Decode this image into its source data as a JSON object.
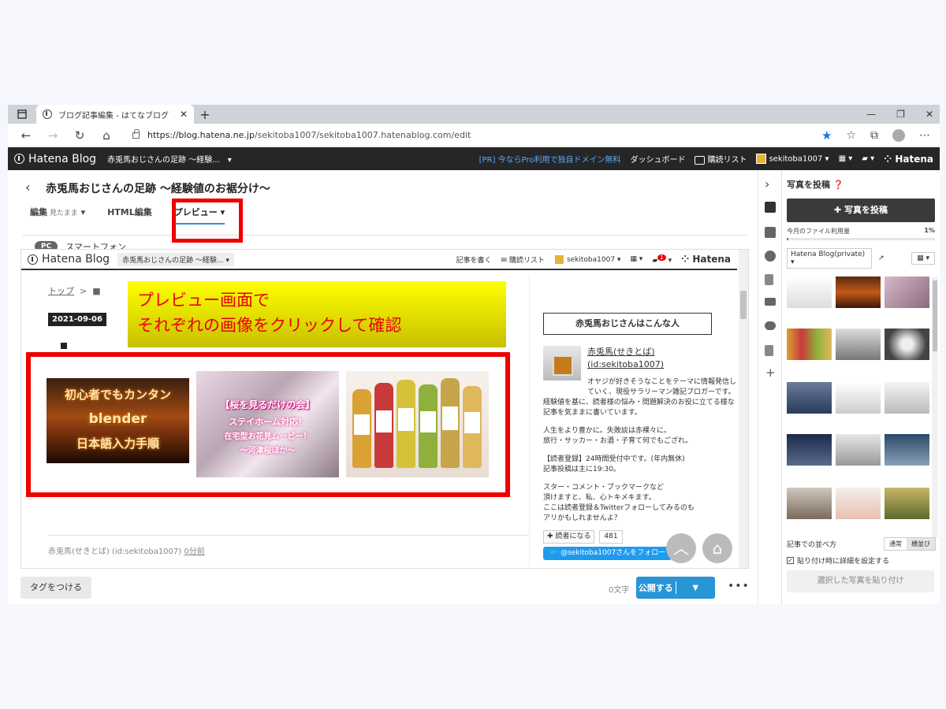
{
  "browser": {
    "tab_title": "ブログ記事編集 - はてなブログ",
    "url_host": "https://blog.hatena.ne.jp",
    "url_path": "/sekitoba1007/sekitoba1007.hatenablog.com/edit"
  },
  "topbar": {
    "logo": "Hatena Blog",
    "blog_selector": "赤兎馬おじさんの足跡 ～経験...",
    "pr_link": "[PR] 今ならPro利用で独自ドメイン無料",
    "dashboard": "ダッシュボード",
    "reading_list": "購読リスト",
    "user": "sekitoba1007",
    "hatena": "Hatena"
  },
  "editor": {
    "title": "赤兎馬おじさんの足跡 ～経験値のお裾分け～",
    "mode_edit": "編集",
    "mode_edit_sub": "見たまま",
    "mode_html": "HTML編集",
    "mode_preview": "プレビュー",
    "device_pc": "PC",
    "device_sp": "スマートフォン"
  },
  "preview": {
    "logo": "Hatena Blog",
    "blog_selector": "赤兎馬おじさんの足跡 ～経験...",
    "write": "記事を書く",
    "reading_list": "購読リスト",
    "user": "sekitoba1007",
    "notif_count": "1",
    "hatena": "Hatena",
    "breadcrumb_top": "トップ",
    "breadcrumb_sep": ">",
    "breadcrumb_cur": "■",
    "date": "2021-09-06",
    "body_mark": "■",
    "callout_line1": "プレビュー画面で",
    "callout_line2": "それぞれの画像をクリックして確認",
    "img1_lines": [
      "初心者でもカンタン",
      "blender",
      "日本語入力手順"
    ],
    "img2_lines": [
      "【桜を見るだけの会】",
      "ステイホーム対応！",
      "在宅型お花見ムービー！",
      "～河津桜ほか～"
    ],
    "author": "赤兎馬(せきとば) (id:sekitoba1007)",
    "author_time": "0分前",
    "side_heading": "赤兎馬おじさんはこんな人",
    "profile_name": "赤兎馬(せきとば)",
    "profile_id": "(id:sekitoba1007)",
    "bio1": "オヤジが好きそうなことをテーマに情報発信していく、現役サラリーマン雑記ブロガーです。",
    "bio2": "経験値を基に、読者様の悩み・問題解決のお役に立てる様な記事を気ままに書いています。",
    "bio3": "人生をより豊かに。失敗談は赤裸々に。",
    "bio4": "旅行・サッカー・お酒・子育て何でもござれ。",
    "bio5": "【読者登録】24時間受付中です。(年内無休)",
    "bio6": "記事投稿は主に19:30。",
    "bio7": "スター・コメント・ブックマークなど",
    "bio8": "頂けますと、私、心トキメキます。",
    "bio9": "ここは読者登録＆Twitterフォローしてみるのも",
    "bio10": "アリかもしれませんよ？",
    "reader_btn": "読者になる",
    "reader_count": "481",
    "twitter_follow": "@sekitoba1007さんをフォロー"
  },
  "footer": {
    "tag_button": "タグをつける",
    "char_count": "0文字",
    "publish": "公開する"
  },
  "panel": {
    "title": "写真を投稿",
    "upload": "写真を投稿",
    "usage_label": "今月のファイル利用量",
    "usage_pct": "1%",
    "usage_fraction": 0.01,
    "folder": "Hatena Blog(private)",
    "sort_label": "記事での並べ方",
    "sort_normal": "通常",
    "sort_tile": "横並び",
    "detail_check": "貼り付け時に詳細を設定する",
    "paste": "選択した写真を貼り付け"
  },
  "colors": {
    "hatena_dark": "#262626",
    "accent_blue": "#2795d6",
    "highlight_red": "#ef0000",
    "callout_yellow": "#ffff00"
  }
}
